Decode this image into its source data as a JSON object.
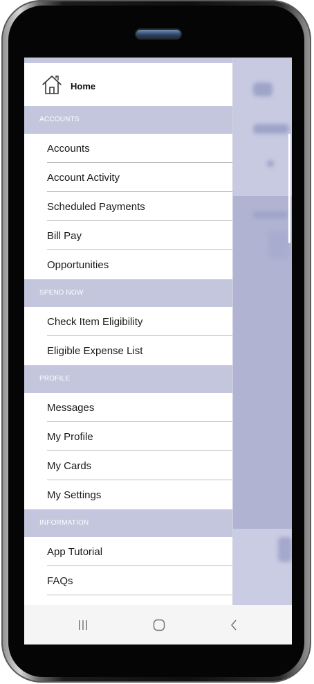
{
  "drawer": {
    "home_label": "Home",
    "sections": [
      {
        "header": "ACCOUNTS",
        "items": [
          "Accounts",
          "Account Activity",
          "Scheduled Payments",
          "Bill Pay",
          "Opportunities"
        ]
      },
      {
        "header": "SPEND NOW",
        "items": [
          "Check Item Eligibility",
          "Eligible Expense List"
        ]
      },
      {
        "header": "PROFILE",
        "items": [
          "Messages",
          "My Profile",
          "My Cards",
          "My Settings"
        ]
      },
      {
        "header": "INFORMATION",
        "items": [
          "App Tutorial",
          "FAQs"
        ]
      }
    ]
  },
  "icons": {
    "home": "home-icon",
    "recent_apps": "recent-apps-icon",
    "nav_home": "nav-home-icon",
    "nav_back": "back-icon"
  },
  "colors": {
    "section_header_bg": "#c3c6dd",
    "section_header_text": "#ffffff",
    "drawer_bg": "#ffffff",
    "overlay_bg": "#b6bad6"
  }
}
